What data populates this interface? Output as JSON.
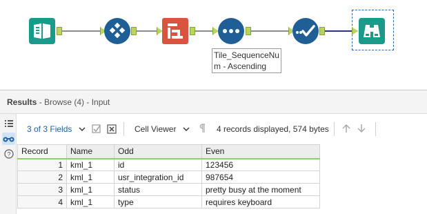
{
  "workflow": {
    "tools": [
      {
        "icon": "input-book-icon",
        "color": "#1a9b8a"
      },
      {
        "icon": "diamond-tile-icon",
        "color": "#1f5f95"
      },
      {
        "icon": "sort-icon",
        "color": "#d9543f"
      },
      {
        "icon": "dots-sequence-icon",
        "color": "#1f5f95"
      },
      {
        "icon": "checkmark-dots-icon",
        "color": "#1f5f95"
      },
      {
        "icon": "binoculars-browse-icon",
        "color": "#1a9b8a"
      }
    ],
    "tool_label": "Tile_SequenceNum - Ascending",
    "anchor_color": "#b9d55f",
    "selected_connection_color": "#2f2f8f"
  },
  "results": {
    "title": "Results",
    "subtitle": " - Browse (4) - Input",
    "toolbar": {
      "fields_label": "3 of 3 Fields",
      "viewer_label": "Cell Viewer",
      "records_status": "4 records displayed, 574 bytes"
    },
    "table": {
      "headers": [
        "Record",
        "Name",
        "Odd",
        "Even"
      ],
      "rows": [
        [
          "1",
          "kml_1",
          "id",
          "123456"
        ],
        [
          "2",
          "kml_1",
          "usr_integration_id",
          "987654"
        ],
        [
          "3",
          "kml_1",
          "status",
          "pretty busy at the moment"
        ],
        [
          "4",
          "kml_1",
          "type",
          "requires keyboard"
        ]
      ]
    },
    "header_accent_color": "#8fd16b"
  }
}
